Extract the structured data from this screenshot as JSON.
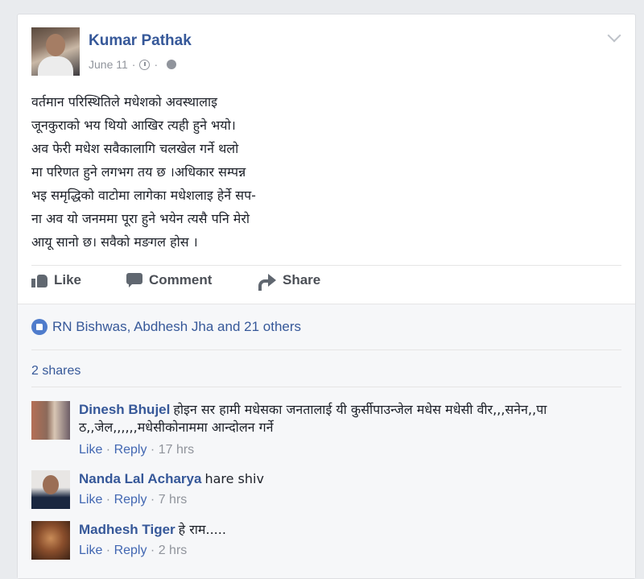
{
  "post": {
    "author": "Kumar Pathak",
    "date": "June 11",
    "dot": "·",
    "text": "वर्तमान परिस्थितिले मधेशको अवस्थालाइ\nजूनकुराको भय थियो आखिर त्यही हुने भयो।\nअव फेरी मधेश सवैकालागि चलखेल गर्ने थलो\nमा परिणत हुने लगभग तय छ ।अधिकार सम्पन्न\nभइ समृद्धिको वाटोमा लागेका मधेशलाइ हेर्ने सप-\nना अव यो जनममा पूरा हुने भयेन त्यसै पनि मेरो\nआयू सानो छ। सवैको मङगल होस ।",
    "icons": [
      "clock-icon",
      "globe-icon",
      "chevron-down-icon"
    ]
  },
  "actions": {
    "like_label": "Like",
    "comment_label": "Comment",
    "share_label": "Share"
  },
  "reactions": {
    "text": "RN Bishwas, Abdhesh Jha and 21 others"
  },
  "shares": {
    "text": "2 shares"
  },
  "comments": [
    {
      "name": "Dinesh Bhujel",
      "text": "होइन सर हामी मधेसका जनतालाई यी कुर्सीपाउन्जेल मधेस मधेसी वीर,,,सनेन,,पा ठ,,जेल,,,,,,मधेसीकोनाममा आन्दोलन गर्ने",
      "like": "Like",
      "reply": "Reply",
      "sep": " · ",
      "time": "17 hrs"
    },
    {
      "name": "Nanda Lal Acharya",
      "text": "hare shiv",
      "like": "Like",
      "reply": "Reply",
      "sep": " · ",
      "time": "7 hrs"
    },
    {
      "name": "Madhesh Tiger",
      "text": "हे राम.....",
      "like": "Like",
      "reply": "Reply",
      "sep": " · ",
      "time": "2 hrs"
    }
  ],
  "colors": {
    "link": "#365899",
    "muted": "#90949c",
    "action": "#4b4f56"
  }
}
